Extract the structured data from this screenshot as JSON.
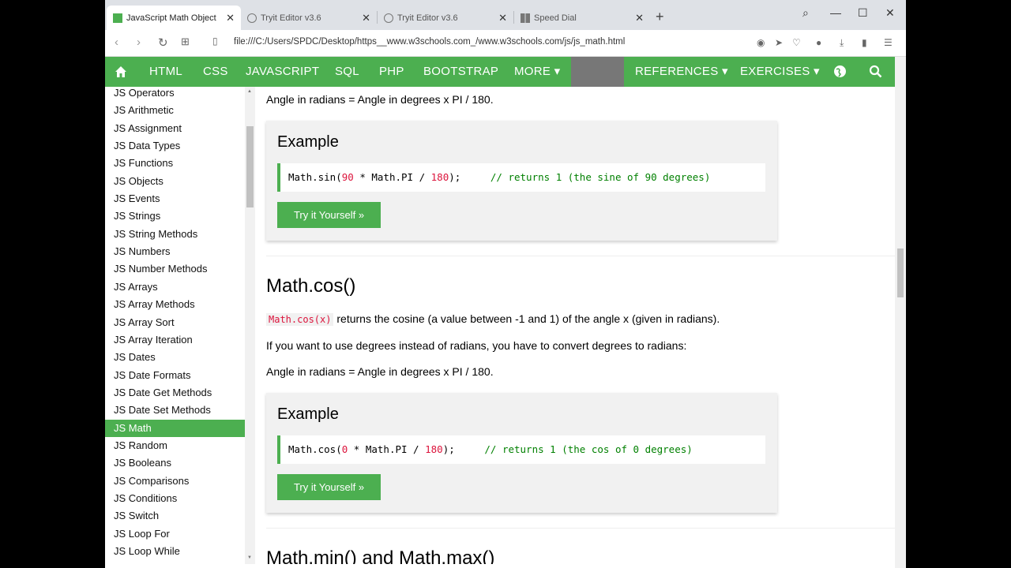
{
  "tabs": [
    {
      "label": "JavaScript Math Object",
      "icon": "w3-favicon",
      "active": true
    },
    {
      "label": "Tryit Editor v3.6",
      "icon": "globe-icon",
      "active": false
    },
    {
      "label": "Tryit Editor v3.6",
      "icon": "globe-icon",
      "active": false
    },
    {
      "label": "Speed Dial",
      "icon": "grid-icon",
      "active": false
    }
  ],
  "address": {
    "url": "file:///C:/Users/SPDC/Desktop/https__www.w3schools.com_/www.w3schools.com/js/js_math.html"
  },
  "nav": {
    "home": "home-icon",
    "items": [
      "HTML",
      "CSS",
      "JAVASCRIPT",
      "SQL",
      "PHP",
      "BOOTSTRAP",
      "MORE ▾",
      "REFERENCES ▾",
      "EXERCISES ▾"
    ]
  },
  "sidebar": {
    "items": [
      "JS Operators",
      "JS Arithmetic",
      "JS Assignment",
      "JS Data Types",
      "JS Functions",
      "JS Objects",
      "JS Events",
      "JS Strings",
      "JS String Methods",
      "JS Numbers",
      "JS Number Methods",
      "JS Arrays",
      "JS Array Methods",
      "JS Array Sort",
      "JS Array Iteration",
      "JS Dates",
      "JS Date Formats",
      "JS Date Get Methods",
      "JS Date Set Methods",
      "JS Math",
      "JS Random",
      "JS Booleans",
      "JS Comparisons",
      "JS Conditions",
      "JS Switch",
      "JS Loop For",
      "JS Loop While"
    ],
    "active": "JS Math"
  },
  "content": {
    "formula1": "Angle in radians = Angle in degrees x PI / 180.",
    "example1": {
      "heading": "Example",
      "code_a": "Math.sin(",
      "num_a": "90",
      "code_b": " * Math.PI / ",
      "num_b": "180",
      "code_c": ");     ",
      "comment": "// returns 1 (the sine of 90 degrees)",
      "button": "Try it Yourself »"
    },
    "cos_title": "Math.cos()",
    "cos_code": "Math.cos(x)",
    "cos_desc": " returns the cosine (a value between -1 and 1) of the angle x (given in radians).",
    "cos_convert": "If you want to use degrees instead of radians, you have to convert degrees to radians:",
    "formula2": "Angle in radians = Angle in degrees x PI / 180.",
    "example2": {
      "heading": "Example",
      "code_a": "Math.cos(",
      "num_a": "0",
      "code_b": " * Math.PI / ",
      "num_b": "180",
      "code_c": ");     ",
      "comment": "// returns 1 (the cos of 0 degrees)",
      "button": "Try it Yourself »"
    },
    "minmax_title": "Math.min() and Math.max()"
  }
}
